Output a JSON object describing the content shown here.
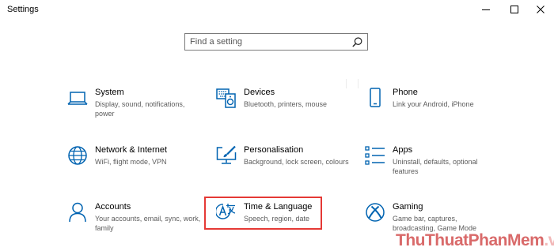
{
  "window": {
    "title": "Settings",
    "controls": [
      {
        "name": "minimize-button",
        "icon": "minimize-icon"
      },
      {
        "name": "maximize-button",
        "icon": "maximize-icon"
      },
      {
        "name": "close-button",
        "icon": "close-icon"
      }
    ]
  },
  "search": {
    "placeholder": "Find a setting",
    "icon": "search-icon"
  },
  "accent_color": "#0063b1",
  "highlight_color": "#e53935",
  "tiles": [
    {
      "title": "System",
      "desc": "Display, sound, notifications, power",
      "icon": "laptop-icon"
    },
    {
      "title": "Devices",
      "desc": "Bluetooth, printers, mouse",
      "icon": "keyboard-speaker-icon"
    },
    {
      "title": "Phone",
      "desc": "Link your Android, iPhone",
      "icon": "phone-icon"
    },
    {
      "title": "Network & Internet",
      "desc": "WiFi, flight mode, VPN",
      "icon": "globe-icon"
    },
    {
      "title": "Personalisation",
      "desc": "Background, lock screen, colours",
      "icon": "paint-monitor-icon"
    },
    {
      "title": "Apps",
      "desc": "Uninstall, defaults, optional features",
      "icon": "apps-list-icon"
    },
    {
      "title": "Accounts",
      "desc": "Your accounts, email, sync, work, family",
      "icon": "person-icon"
    },
    {
      "title": "Time & Language",
      "desc": "Speech, region, date",
      "icon": "time-language-icon",
      "highlighted": true
    },
    {
      "title": "Gaming",
      "desc": "Game bar, captures, broadcasting, Game Mode",
      "icon": "xbox-icon"
    }
  ],
  "watermark": {
    "part1": "ThuThuat",
    "part2": "PhanMem",
    "part3": ".vn"
  }
}
